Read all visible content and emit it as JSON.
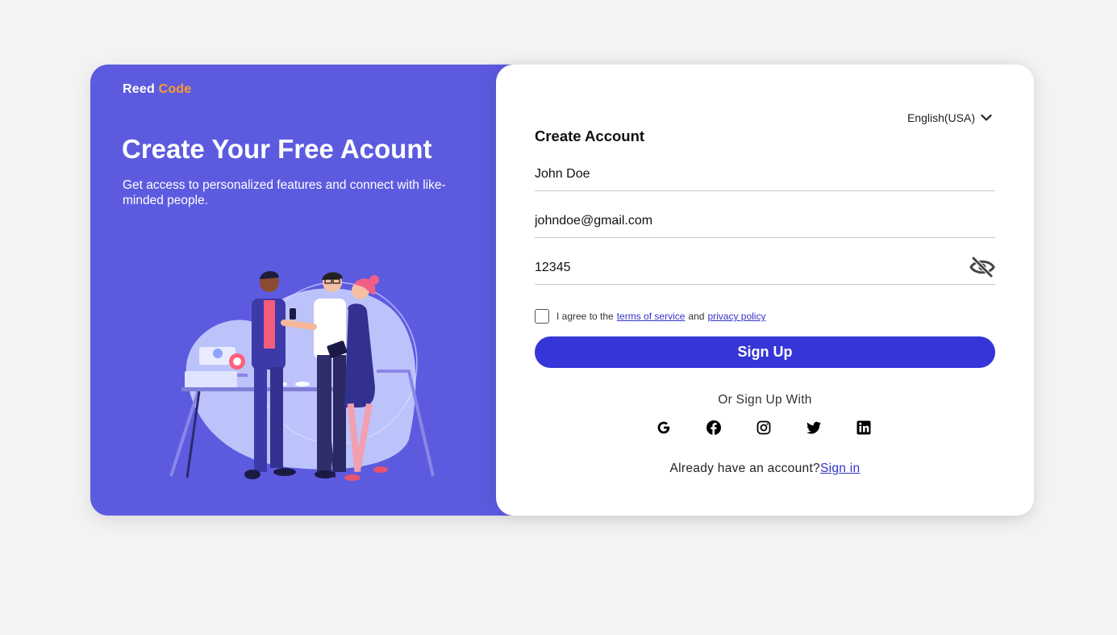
{
  "brand": {
    "first": "Reed",
    "second": "Code"
  },
  "hero": {
    "title": "Create Your Free Acount",
    "subtitle": "Get access to personalized features and connect with like-minded people."
  },
  "language": {
    "selected": "English(USA)"
  },
  "form": {
    "title": "Create Account",
    "name_value": "John Doe",
    "email_value": "johndoe@gmail.com",
    "password_value": "12345",
    "agree_prefix": "I agree to the",
    "terms_link": "terms of service",
    "and_text": "and",
    "privacy_link": "privacy policy",
    "signup_label": "Sign Up",
    "or_text": "Or Sign Up With",
    "already_text": "Already have an account?",
    "signin_link": "Sign in"
  },
  "socials": [
    "google-icon",
    "facebook-icon",
    "instagram-icon",
    "twitter-icon",
    "linkedin-icon"
  ],
  "colors": {
    "panel": "#5c5be0",
    "brand_accent": "#ff9c2b",
    "button": "#3535d8",
    "link": "#3333cc",
    "background": "#f3f3f3"
  }
}
